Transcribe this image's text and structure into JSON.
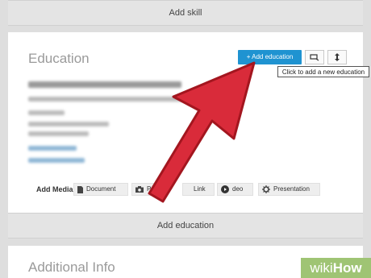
{
  "top_bar": {
    "label": "Add skill"
  },
  "education": {
    "title": "Education",
    "add_button": "+ Add education",
    "tooltip": "Click to add a new education",
    "add_media": {
      "label": "Add Media:",
      "items": [
        {
          "label": "Document",
          "icon": "document-icon"
        },
        {
          "label": "P",
          "icon": "camera-icon"
        },
        {
          "label": "Link",
          "icon": "link-icon"
        },
        {
          "label": "deo",
          "icon": "video-icon"
        },
        {
          "label": "Presentation",
          "icon": "presentation-icon"
        }
      ]
    },
    "bottom_bar": "Add education"
  },
  "additional": {
    "title": "Additional Info"
  },
  "watermark": {
    "wiki": "wiki",
    "how": "How"
  },
  "colors": {
    "primary": "#1f93d1",
    "arrow": "#d92b3a",
    "watermark": "#9fc474"
  }
}
